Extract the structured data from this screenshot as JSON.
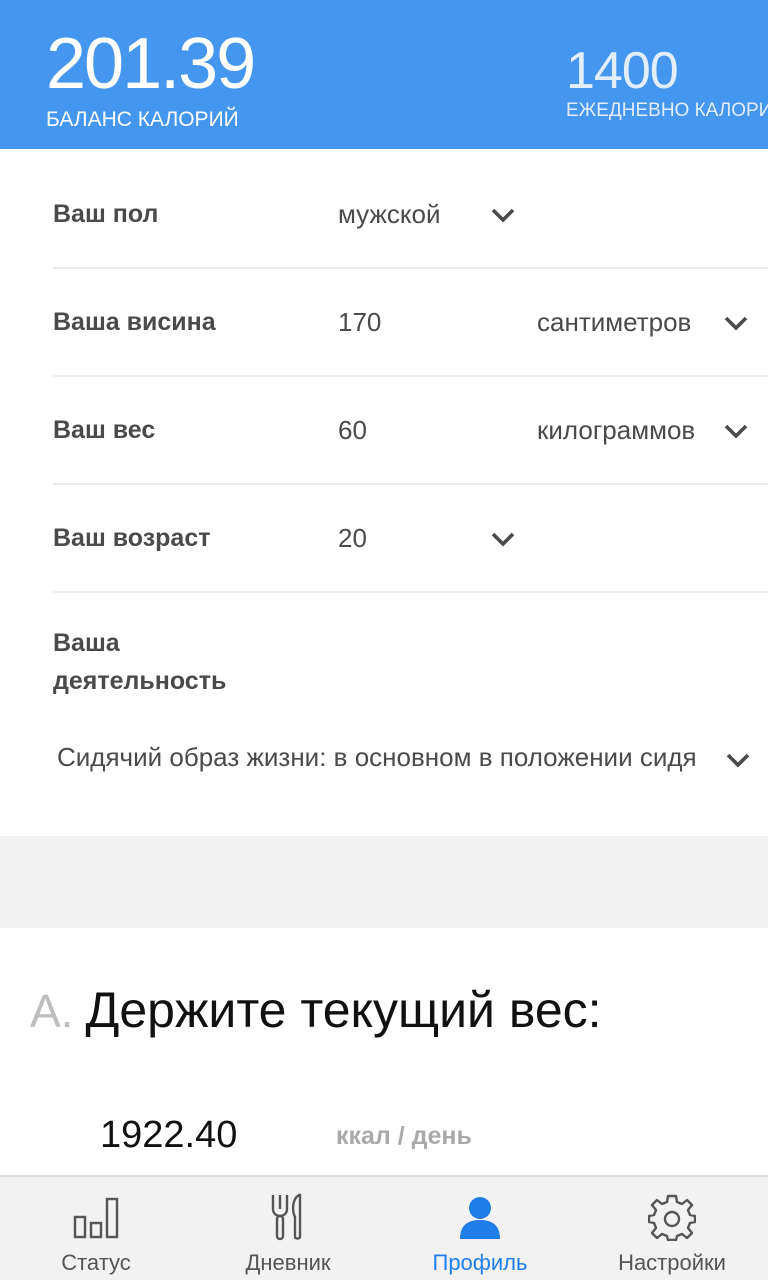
{
  "header": {
    "balance_value": "201.39",
    "balance_label": "БАЛАНС КАЛОРИЙ",
    "daily_value": "1400",
    "daily_label": "ЕЖЕДНЕВНО КАЛОРИЙ"
  },
  "profile": {
    "gender": {
      "label": "Ваш пол",
      "value": "мужской",
      "icon": "chevron-down-icon"
    },
    "height": {
      "label": "Ваша висина",
      "value": "170",
      "unit": "сантиметров",
      "icon": "chevron-down-icon"
    },
    "weight": {
      "label": "Ваш вес",
      "value": "60",
      "unit": "килограммов",
      "icon": "chevron-down-icon"
    },
    "age": {
      "label": "Ваш возраст",
      "value": "20",
      "icon": "chevron-down-icon"
    },
    "activity": {
      "label_line1": "Ваша",
      "label_line2": "деятельность",
      "value": "Сидячий образ жизни: в основном в положении сидя",
      "icon": "chevron-down-icon"
    }
  },
  "section_a": {
    "letter": "A.",
    "title": "Держите текущий вес:",
    "kcal_value": "1922.40",
    "kcal_unit": "ккал / день"
  },
  "nav": {
    "items": [
      {
        "label": "Статус",
        "icon": "bar-chart-icon",
        "active": false
      },
      {
        "label": "Дневник",
        "icon": "fork-knife-icon",
        "active": false
      },
      {
        "label": "Профиль",
        "icon": "person-icon",
        "active": true
      },
      {
        "label": "Настройки",
        "icon": "gear-icon",
        "active": false
      }
    ]
  },
  "colors": {
    "header_bg": "#4496ef",
    "accent": "#1f7ee9",
    "nav_bg": "#f2f2f2"
  }
}
